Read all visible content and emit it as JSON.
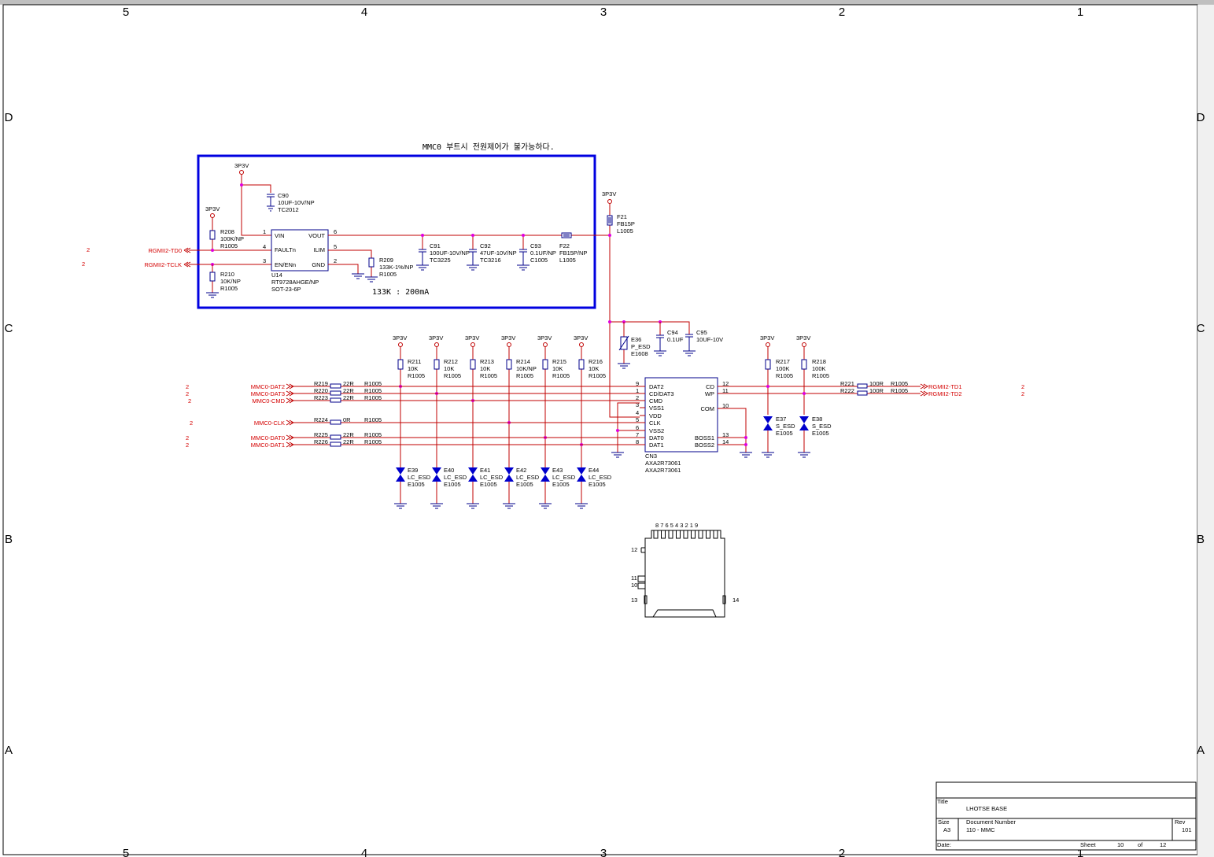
{
  "border": {
    "top_cols": [
      "5",
      "4",
      "3",
      "2",
      "1"
    ],
    "bottom_cols": [
      "5",
      "4",
      "3",
      "2",
      "1"
    ],
    "left_rows": [
      "D",
      "C",
      "B",
      "A"
    ],
    "right_rows": [
      "D",
      "C",
      "B",
      "A"
    ]
  },
  "note": "MMC0 부트시 전원제어가 불가능하다.",
  "ratio_note": "133K : 200mA",
  "power_label": "3P3V",
  "ports_left": [
    {
      "label": "RGMII2-TD0",
      "page": "2"
    },
    {
      "label": "RGMII2-TCLK",
      "page": "2"
    },
    {
      "label": "MMC0-DAT2",
      "page": "2"
    },
    {
      "label": "MMC0-DAT3",
      "page": "2"
    },
    {
      "label": "MMC0-CMD",
      "page": "2"
    },
    {
      "label": "MMC0-CLK",
      "page": "2"
    },
    {
      "label": "MMC0-DAT0",
      "page": "2"
    },
    {
      "label": "MMC0-DAT1",
      "page": "2"
    }
  ],
  "ports_right": [
    {
      "label": "RGMII2-TD1",
      "page": "2"
    },
    {
      "label": "RGMII2-TD2",
      "page": "2"
    }
  ],
  "u14": {
    "ref": "U14",
    "part": "RT9728AHGE/NP",
    "pkg": "SOT-23-6P",
    "pins_left": [
      {
        "name": "VIN",
        "num": "1"
      },
      {
        "name": "FAULTn",
        "num": "4"
      },
      {
        "name": "EN/ENn",
        "num": "3"
      }
    ],
    "pins_right": [
      {
        "name": "VOUT",
        "num": "6"
      },
      {
        "name": "ILIM",
        "num": "5"
      },
      {
        "name": "GND",
        "num": "2"
      }
    ]
  },
  "power_parts": [
    {
      "ref": "C90",
      "value": "10UF-10V/NP",
      "pkg": "TC2012"
    },
    {
      "ref": "R208",
      "value": "100K/NP",
      "pkg": "R1005"
    },
    {
      "ref": "R210",
      "value": "10K/NP",
      "pkg": "R1005"
    },
    {
      "ref": "R209",
      "value": "133K-1%/NP",
      "pkg": "R1005"
    },
    {
      "ref": "C91",
      "value": "100UF-10V/NP",
      "pkg": "TC3225"
    },
    {
      "ref": "C92",
      "value": "47UF-10V/NP",
      "pkg": "TC3216"
    },
    {
      "ref": "C93",
      "value": "0.1UF/NP",
      "pkg": "C1005"
    },
    {
      "ref": "F22",
      "value": "FB15P/NP",
      "pkg": "L1005"
    },
    {
      "ref": "F21",
      "value": "FB15P",
      "pkg": "L1005"
    }
  ],
  "decoupling": [
    {
      "ref": "E36",
      "value": "P_ESD",
      "pkg": "E1608"
    },
    {
      "ref": "C94",
      "value": "0.1UF"
    },
    {
      "ref": "C95",
      "value": "10UF-10V"
    }
  ],
  "pullups": [
    {
      "ref": "R211",
      "value": "10K",
      "pkg": "R1005"
    },
    {
      "ref": "R212",
      "value": "10K",
      "pkg": "R1005"
    },
    {
      "ref": "R213",
      "value": "10K",
      "pkg": "R1005"
    },
    {
      "ref": "R214",
      "value": "10K/NP",
      "pkg": "R1005"
    },
    {
      "ref": "R215",
      "value": "10K",
      "pkg": "R1005"
    },
    {
      "ref": "R216",
      "value": "10K",
      "pkg": "R1005"
    }
  ],
  "series_res": [
    {
      "ref": "R219",
      "value": "22R",
      "pkg": "R1005"
    },
    {
      "ref": "R220",
      "value": "22R",
      "pkg": "R1005"
    },
    {
      "ref": "R223",
      "value": "22R",
      "pkg": "R1005"
    },
    {
      "ref": "R224",
      "value": "0R",
      "pkg": "R1005"
    },
    {
      "ref": "R225",
      "value": "22R",
      "pkg": "R1005"
    },
    {
      "ref": "R226",
      "value": "22R",
      "pkg": "R1005"
    }
  ],
  "esd_lc": [
    {
      "ref": "E39",
      "value": "LC_ESD",
      "pkg": "E1005"
    },
    {
      "ref": "E40",
      "value": "LC_ESD",
      "pkg": "E1005"
    },
    {
      "ref": "E41",
      "value": "LC_ESD",
      "pkg": "E1005"
    },
    {
      "ref": "E42",
      "value": "LC_ESD",
      "pkg": "E1005"
    },
    {
      "ref": "E43",
      "value": "LC_ESD",
      "pkg": "E1005"
    },
    {
      "ref": "E44",
      "value": "LC_ESD",
      "pkg": "E1005"
    }
  ],
  "cn3": {
    "ref": "CN3",
    "part": "AXA2R73061",
    "part2": "AXA2R73061",
    "pins_left": [
      {
        "name": "DAT2",
        "num": "9"
      },
      {
        "name": "CD/DAT3",
        "num": "1"
      },
      {
        "name": "CMD",
        "num": "2"
      },
      {
        "name": "VSS1",
        "num": "3"
      },
      {
        "name": "VDD",
        "num": "4"
      },
      {
        "name": "CLK",
        "num": "5"
      },
      {
        "name": "VSS2",
        "num": "6"
      },
      {
        "name": "DAT0",
        "num": "7"
      },
      {
        "name": "DAT1",
        "num": "8"
      }
    ],
    "pins_right": [
      {
        "name": "CD",
        "num": "12"
      },
      {
        "name": "WP",
        "num": "11"
      },
      {
        "name": "COM",
        "num": "10"
      },
      {
        "name": "BOSS1",
        "num": "13"
      },
      {
        "name": "BOSS2",
        "num": "14"
      }
    ]
  },
  "right_parts": [
    {
      "ref": "R217",
      "value": "100K",
      "pkg": "R1005"
    },
    {
      "ref": "R218",
      "value": "100K",
      "pkg": "R1005"
    },
    {
      "ref": "E37",
      "value": "S_ESD",
      "pkg": "E1005"
    },
    {
      "ref": "E38",
      "value": "S_ESD",
      "pkg": "E1005"
    },
    {
      "ref": "R221",
      "value": "100R",
      "pkg": "R1005"
    },
    {
      "ref": "R222",
      "value": "100R",
      "pkg": "R1005"
    }
  ],
  "footprint": {
    "top_pins": "8 7 6 5 4 3 2 1 9",
    "pins": [
      "12",
      "11",
      "10",
      "13",
      "14"
    ]
  },
  "title_block": {
    "title_label": "Title",
    "title": "LHOTSE BASE",
    "size_label": "Size",
    "size": "A3",
    "docnum_label": "Document Number",
    "docnum": "110 - MMC",
    "rev_label": "Rev",
    "rev": "101",
    "date_label": "Date:",
    "sheet_label": "Sheet",
    "sheet": "10",
    "of_label": "of",
    "total": "12"
  }
}
